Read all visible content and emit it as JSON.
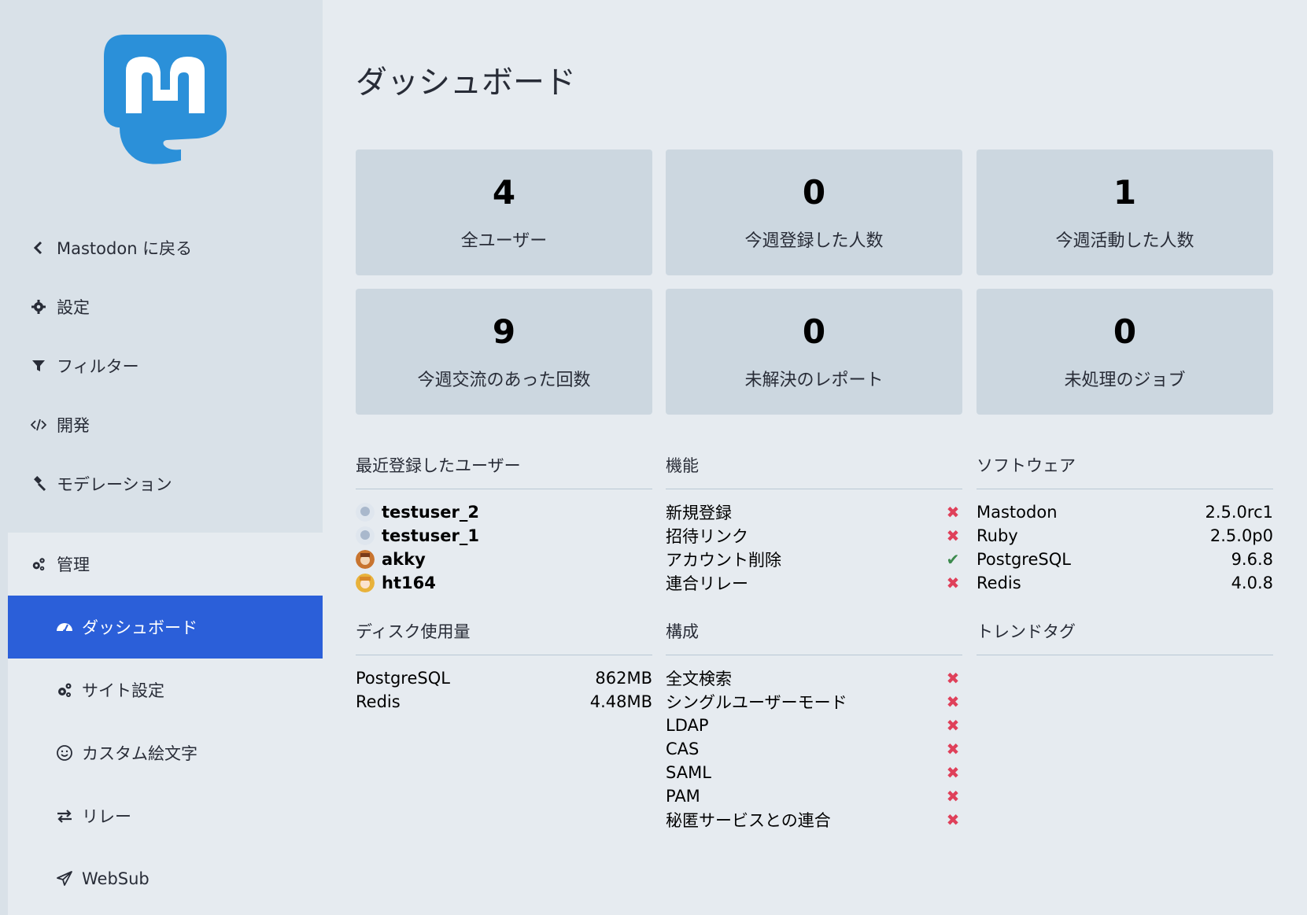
{
  "sidebar": {
    "items": [
      {
        "label": "Mastodon に戻る",
        "icon": "chevron-left-icon"
      },
      {
        "label": "設定",
        "icon": "gear-icon"
      },
      {
        "label": "フィルター",
        "icon": "filter-icon"
      },
      {
        "label": "開発",
        "icon": "code-icon"
      },
      {
        "label": "モデレーション",
        "icon": "gavel-icon"
      },
      {
        "label": "管理",
        "icon": "cogs-icon"
      }
    ],
    "admin_items": [
      {
        "label": "ダッシュボード",
        "icon": "dashboard-icon",
        "active": true
      },
      {
        "label": "サイト設定",
        "icon": "cogs-icon"
      },
      {
        "label": "カスタム絵文字",
        "icon": "smile-icon"
      },
      {
        "label": "リレー",
        "icon": "exchange-icon"
      },
      {
        "label": "WebSub",
        "icon": "paper-plane-icon"
      }
    ]
  },
  "page": {
    "title": "ダッシュボード"
  },
  "cards": [
    {
      "value": "4",
      "label": "全ユーザー"
    },
    {
      "value": "0",
      "label": "今週登録した人数"
    },
    {
      "value": "1",
      "label": "今週活動した人数"
    },
    {
      "value": "9",
      "label": "今週交流のあった回数"
    },
    {
      "value": "0",
      "label": "未解決のレポート"
    },
    {
      "value": "0",
      "label": "未処理のジョブ"
    }
  ],
  "recent_users": {
    "title": "最近登録したユーザー",
    "users": [
      "testuser_2",
      "testuser_1",
      "akky",
      "ht164"
    ]
  },
  "features": {
    "title": "機能",
    "items": [
      {
        "label": "新規登録",
        "enabled": false
      },
      {
        "label": "招待リンク",
        "enabled": false
      },
      {
        "label": "アカウント削除",
        "enabled": true
      },
      {
        "label": "連合リレー",
        "enabled": false
      }
    ]
  },
  "software": {
    "title": "ソフトウェア",
    "items": [
      {
        "name": "Mastodon",
        "version": "2.5.0rc1"
      },
      {
        "name": "Ruby",
        "version": "2.5.0p0"
      },
      {
        "name": "PostgreSQL",
        "version": "9.6.8"
      },
      {
        "name": "Redis",
        "version": "4.0.8"
      }
    ]
  },
  "disk": {
    "title": "ディスク使用量",
    "items": [
      {
        "name": "PostgreSQL",
        "size": "862MB"
      },
      {
        "name": "Redis",
        "size": "4.48MB"
      }
    ]
  },
  "config": {
    "title": "構成",
    "items": [
      {
        "label": "全文検索",
        "enabled": false
      },
      {
        "label": "シングルユーザーモード",
        "enabled": false
      },
      {
        "label": "LDAP",
        "enabled": false
      },
      {
        "label": "CAS",
        "enabled": false
      },
      {
        "label": "SAML",
        "enabled": false
      },
      {
        "label": "PAM",
        "enabled": false
      },
      {
        "label": "秘匿サービスとの連合",
        "enabled": false
      }
    ]
  },
  "trends": {
    "title": "トレンドタグ"
  },
  "marks": {
    "on": "✔",
    "off": "✖"
  },
  "colors": {
    "accent": "#2b5fd9",
    "brand": "#2b90d9",
    "check": "#3c8a4d",
    "cross": "#df405a"
  }
}
